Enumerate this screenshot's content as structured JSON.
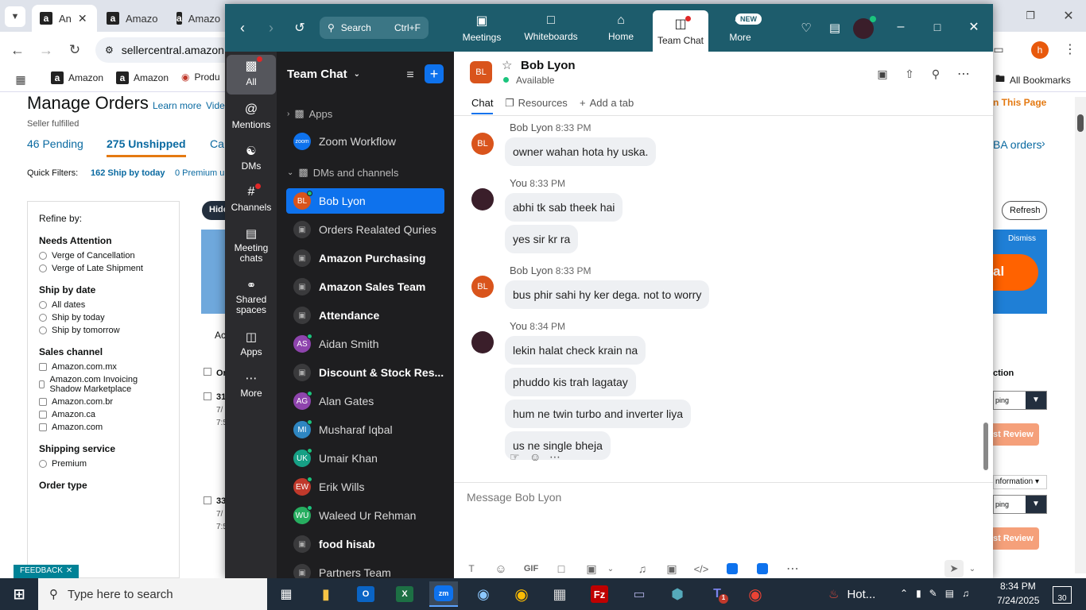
{
  "browser": {
    "tabs": [
      {
        "label": "An"
      },
      {
        "label": "Amazo"
      },
      {
        "label": "Amazo"
      }
    ],
    "url": "sellercentral.amazon",
    "bookmarks": [
      {
        "label": "Amazon"
      },
      {
        "label": "Amazon"
      },
      {
        "label": "Produ"
      }
    ],
    "all_bookmarks": "All Bookmarks",
    "profile": "h"
  },
  "amazon": {
    "title": "Manage Orders",
    "learn_more": "Learn more",
    "video": "Vide",
    "seller_fulfilled": "Seller fulfilled",
    "pending": "46 Pending",
    "unshipped": "275 Unshipped",
    "canceled": "Ca",
    "quick_filters": "Quick Filters:",
    "ship_today": "162 Ship by today",
    "premium": "0 Premium u",
    "hide": "Hide",
    "ac": "Ac",
    "rate_page": "n This Page",
    "fba_orders": "BA orders",
    "refresh": "Refresh",
    "dismiss": "Dismiss",
    "banner_text": "al",
    "action_header": "ction",
    "shipping": "ping",
    "review": "st Review",
    "information": "nformation",
    "order_col": "Or",
    "order1": "31",
    "order1_date": "7/",
    "order1_time": "7:5",
    "order2": "33",
    "order2_date": "7/",
    "order2_time": "7:5",
    "feedback": "FEEDBACK",
    "refine": {
      "title": "Refine by:",
      "sections": [
        {
          "heading": "Needs Attention",
          "type": "radio",
          "items": [
            "Verge of Cancellation",
            "Verge of Late Shipment"
          ]
        },
        {
          "heading": "Ship by date",
          "type": "radio",
          "items": [
            "All dates",
            "Ship by today",
            "Ship by tomorrow"
          ]
        },
        {
          "heading": "Sales channel",
          "type": "check",
          "items": [
            "Amazon.com.mx",
            "Amazon.com Invoicing Shadow Marketplace",
            "Amazon.com.br",
            "Amazon.ca",
            "Amazon.com"
          ]
        },
        {
          "heading": "Shipping service",
          "type": "radio",
          "items": [
            "Premium"
          ]
        },
        {
          "heading": "Order type",
          "type": "check",
          "items": []
        }
      ]
    }
  },
  "zoom": {
    "search_label": "Search",
    "search_shortcut": "Ctrl+F",
    "nav": [
      {
        "label": "Meetings"
      },
      {
        "label": "Whiteboards"
      },
      {
        "label": "Home"
      },
      {
        "label": "Team Chat"
      },
      {
        "label": "More"
      }
    ],
    "new_badge": "NEW",
    "rail": [
      {
        "label": "All"
      },
      {
        "label": "Mentions"
      },
      {
        "label": "DMs"
      },
      {
        "label": "Channels"
      },
      {
        "label": "Meeting chats"
      },
      {
        "label": "Shared spaces"
      },
      {
        "label": "Apps"
      },
      {
        "label": "More"
      }
    ],
    "list_title": "Team Chat",
    "apps_section": "Apps",
    "zoom_workflow": "Zoom Workflow",
    "zoom_logo": "zoom",
    "dm_section": "DMs and channels",
    "items": [
      {
        "name": "Bob Lyon",
        "initials": "BL",
        "color": "#d9541c",
        "kind": "person"
      },
      {
        "name": "Orders Realated Quries",
        "kind": "channel"
      },
      {
        "name": "Amazon Purchasing",
        "kind": "channel",
        "bold": true
      },
      {
        "name": "Amazon Sales Team",
        "kind": "channel",
        "bold": true
      },
      {
        "name": "Attendance",
        "kind": "channel",
        "bold": true
      },
      {
        "name": "Aidan Smith",
        "initials": "AS",
        "color": "#8e44ad",
        "kind": "person"
      },
      {
        "name": "Discount & Stock Res...",
        "kind": "channel",
        "bold": true
      },
      {
        "name": "Alan Gates",
        "initials": "AG",
        "color": "#8e44ad",
        "kind": "person"
      },
      {
        "name": "Musharaf Iqbal",
        "initials": "MI",
        "color": "#2e86c1",
        "kind": "person"
      },
      {
        "name": "Umair Khan",
        "initials": "UK",
        "color": "#16a085",
        "kind": "person"
      },
      {
        "name": "Erik Wills",
        "initials": "EW",
        "color": "#c0392b",
        "kind": "person"
      },
      {
        "name": "Waleed Ur Rehman",
        "initials": "WU",
        "color": "#27ae60",
        "kind": "person"
      },
      {
        "name": "food hisab",
        "kind": "channel",
        "bold": true
      },
      {
        "name": "Partners Team",
        "kind": "channel"
      }
    ],
    "contact": {
      "name": "Bob Lyon",
      "initials": "BL",
      "status": "Available"
    },
    "tabs": {
      "chat": "Chat",
      "resources": "Resources",
      "add": "Add a tab"
    },
    "messages": [
      {
        "sender": "Bob Lyon",
        "time": "8:33 PM",
        "lines": [
          "owner wahan hota hy uska."
        ]
      },
      {
        "sender": "You",
        "time": "8:33 PM",
        "lines": [
          "abhi tk sab theek hai",
          "yes sir kr ra"
        ]
      },
      {
        "sender": "Bob Lyon",
        "time": "8:33 PM",
        "lines": [
          "bus phir sahi hy ker dega. not to worry"
        ]
      },
      {
        "sender": "You",
        "time": "8:34 PM",
        "lines": [
          "lekin halat check krain na",
          "phuddo kis trah lagatay",
          "hum ne twin turbo and inverter liya",
          "us ne single bheja"
        ]
      }
    ],
    "composer_placeholder": "Message Bob Lyon",
    "gif": "GIF"
  },
  "taskbar": {
    "search_placeholder": "Type here to search",
    "weather": "Hot...",
    "time": "8:34 PM",
    "date": "7/24/2025",
    "notifications": "30",
    "teams_badge": "1"
  }
}
